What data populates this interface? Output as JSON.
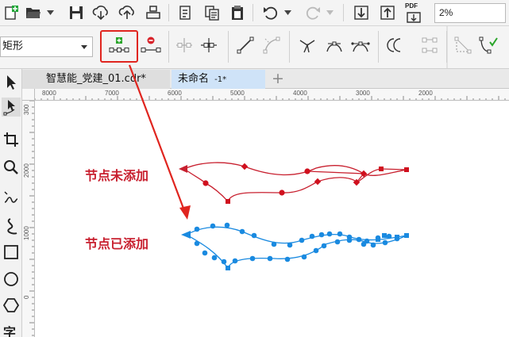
{
  "toolbar": {
    "zoom_value": "2%",
    "pdf_label": "PDF"
  },
  "property_bar": {
    "shape_value": "矩形"
  },
  "tabs": [
    {
      "label": "智慧能_党建_01.cdr*"
    },
    {
      "label": "未命名",
      "suffix": "-1*"
    }
  ],
  "new_tab_label": "+",
  "ruler": {
    "h_labels": [
      "8000",
      "7000",
      "6000",
      "5000",
      "4000",
      "3000",
      "2000"
    ],
    "v_labels": [
      "300",
      "2000",
      "1000",
      "0"
    ]
  },
  "annotations": {
    "before": "节点未添加",
    "after": "节点已添加"
  },
  "colors": {
    "curve_before": "#c8202f",
    "curve_after": "#1a8ae0",
    "highlight": "#e0251f",
    "add_node_icon": "#2aa52a",
    "delete_node_icon": "#d8232a",
    "active_tab": "#cfe3f8"
  },
  "partial_text": {
    "left_tool_bottom": "字"
  }
}
